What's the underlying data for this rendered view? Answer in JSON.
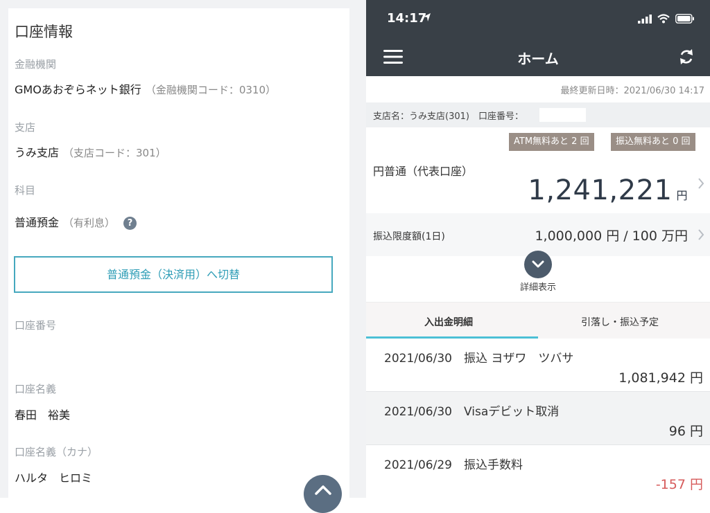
{
  "left": {
    "title": "口座情報",
    "bank_label": "金融機関",
    "bank_name": "GMOあおぞらネット銀行",
    "bank_code": "（金融機関コード：0310）",
    "branch_label": "支店",
    "branch_name": "うみ支店",
    "branch_code": "（支店コード：301）",
    "subject_label": "科目",
    "subject_value": "普通預金",
    "subject_note": "（有利息）",
    "help_symbol": "?",
    "switch_button": "普通預金（決済用）へ切替",
    "account_number_label": "口座番号",
    "account_name_label": "口座名義",
    "account_name": "春田　裕美",
    "account_kana_label": "口座名義（カナ）",
    "account_kana": "ハルタ　ヒロミ"
  },
  "phone": {
    "status_time": "14:17",
    "nav_title": "ホーム",
    "last_updated": "最終更新日時：2021/06/30 14:17",
    "branch_info": "支店名：うみ支店(301)　口座番号：",
    "badge_atm": "ATM無料あと 2 回",
    "badge_transfer": "振込無料あと 0 回",
    "account_type": "円普通（代表口座）",
    "balance": "1,241,221",
    "balance_unit": "円",
    "limit_label": "振込限度額(1日)",
    "limit_value": "1,000,000 円 / 100 万円",
    "detail_label": "詳細表示",
    "tab_history": "入出金明細",
    "tab_scheduled": "引落し・振込予定",
    "transactions": [
      {
        "description": "2021/06/30　振込  ヨザワ　ツバサ",
        "amount": "1,081,942 円"
      },
      {
        "description": "2021/06/30　Visaデビット取消",
        "amount": "96 円"
      },
      {
        "description": "2021/06/29　振込手数料",
        "amount": "-157 円"
      }
    ]
  },
  "colors": {
    "header_bg": "#394047",
    "accent": "#45a8be",
    "badge": "#9a8e86",
    "negative": "#d65a5a"
  },
  "icons": [
    "location-arrow-icon",
    "signal-icon",
    "wifi-icon",
    "battery-icon",
    "hamburger-menu-icon",
    "refresh-icon",
    "chevron-right-icon",
    "chevron-down-icon",
    "chevron-up-icon",
    "help-icon"
  ]
}
